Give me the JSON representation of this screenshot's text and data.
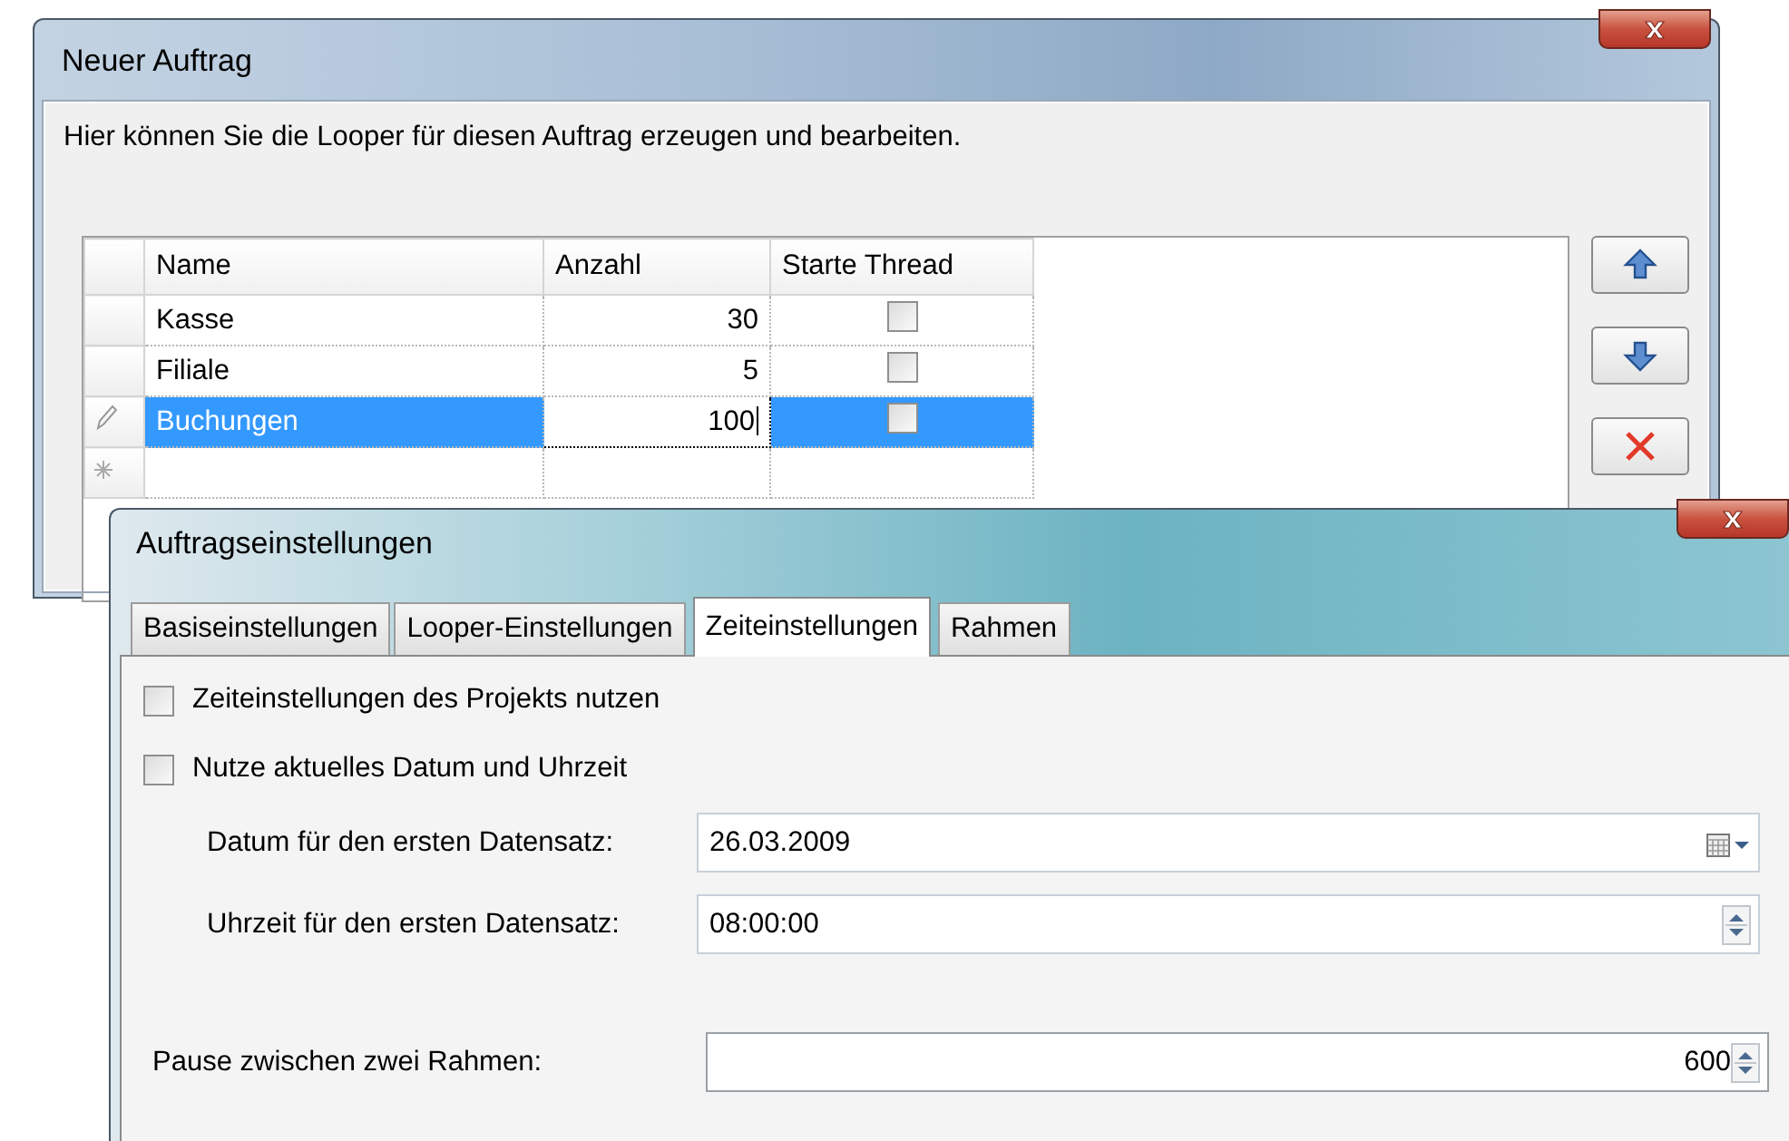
{
  "order_window": {
    "title": "Neuer Auftrag",
    "description": "Hier können Sie die Looper für diesen Auftrag erzeugen und bearbeiten.",
    "grid": {
      "columns": [
        "Name",
        "Anzahl",
        "Starte Thread"
      ],
      "rows": [
        {
          "name": "Kasse",
          "count": "30",
          "start_thread": false,
          "selected": false,
          "editing": false
        },
        {
          "name": "Filiale",
          "count": "5",
          "start_thread": false,
          "selected": false,
          "editing": false
        },
        {
          "name": "Buchungen",
          "count": "100",
          "start_thread": false,
          "selected": true,
          "editing": true
        }
      ],
      "new_row": true
    }
  },
  "settings_window": {
    "title": "Auftragseinstellungen",
    "tabs": [
      {
        "label": "Basiseinstellungen",
        "selected": false
      },
      {
        "label": "Looper-Einstellungen",
        "selected": false
      },
      {
        "label": "Zeiteinstellungen",
        "selected": true
      },
      {
        "label": "Rahmen",
        "selected": false
      }
    ],
    "checkboxes": [
      {
        "label": "Zeiteinstellungen des Projekts nutzen",
        "checked": false
      },
      {
        "label": "Nutze aktuelles Datum und Uhrzeit",
        "checked": false
      }
    ],
    "fields": [
      {
        "kind": "date",
        "label": "Datum für den ersten Datensatz:",
        "value": "26.03.2009"
      },
      {
        "kind": "time",
        "label": "Uhrzeit für den ersten Datensatz:",
        "value": "08:00:00"
      },
      {
        "kind": "number",
        "label": "Pause zwischen zwei Rahmen:",
        "value": "600"
      }
    ]
  }
}
